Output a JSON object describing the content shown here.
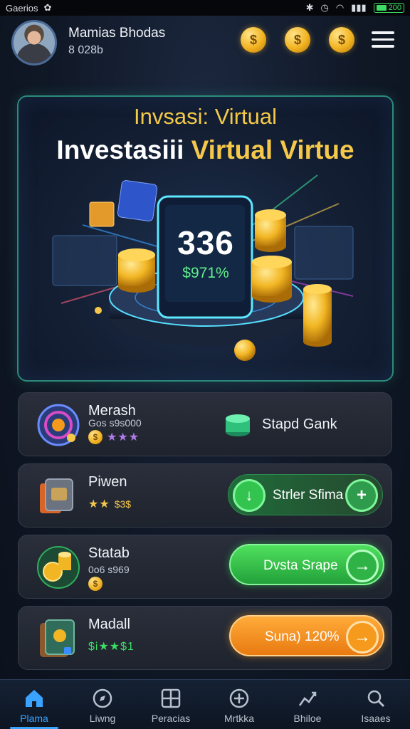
{
  "status_bar": {
    "carrier": "Gaerios",
    "battery": "200"
  },
  "user": {
    "name": "Mamias Bhodas",
    "id": "8 028b"
  },
  "header_icons": [
    "dollar-coin-icon",
    "dollar-coin-icon",
    "coin-bag-icon",
    "menu-icon"
  ],
  "hero": {
    "title_top": "Invsasi: Virtual",
    "title_main_white": "Investasiii ",
    "title_main_gold": "Virtual Virtue",
    "value": "336",
    "percent": "$971%"
  },
  "items": [
    {
      "title": "Merash",
      "sub_text": "Gos s9s000",
      "stars": "★★★",
      "action_label": "Stapd Gank",
      "action_style": "plain"
    },
    {
      "title": "Piwen",
      "sub_text": "$3$",
      "stars": "★★",
      "action_label": "Strler Sfima",
      "action_style": "dark-green"
    },
    {
      "title": "Statab",
      "sub_text": "0o6 s969",
      "stars": "",
      "action_label": "Dvsta Srape",
      "action_style": "green"
    },
    {
      "title": "Madall",
      "sub_text": "$i★★$1",
      "stars": "",
      "action_label": "Suna) 120%",
      "action_style": "orange"
    }
  ],
  "nav": [
    {
      "label": "Plama",
      "icon": "home-icon",
      "active": true
    },
    {
      "label": "Liwng",
      "icon": "compass-icon",
      "active": false
    },
    {
      "label": "Peracias",
      "icon": "grid-icon",
      "active": false
    },
    {
      "label": "Mrtkka",
      "icon": "plus-circle-icon",
      "active": false
    },
    {
      "label": "Bhiloe",
      "icon": "chart-icon",
      "active": false
    },
    {
      "label": "Isaaes",
      "icon": "search-icon",
      "active": false
    }
  ],
  "colors": {
    "accent": "#3aa3ff",
    "gold": "#f5c84a",
    "green": "#3ddc62",
    "orange": "#f59a1c"
  }
}
